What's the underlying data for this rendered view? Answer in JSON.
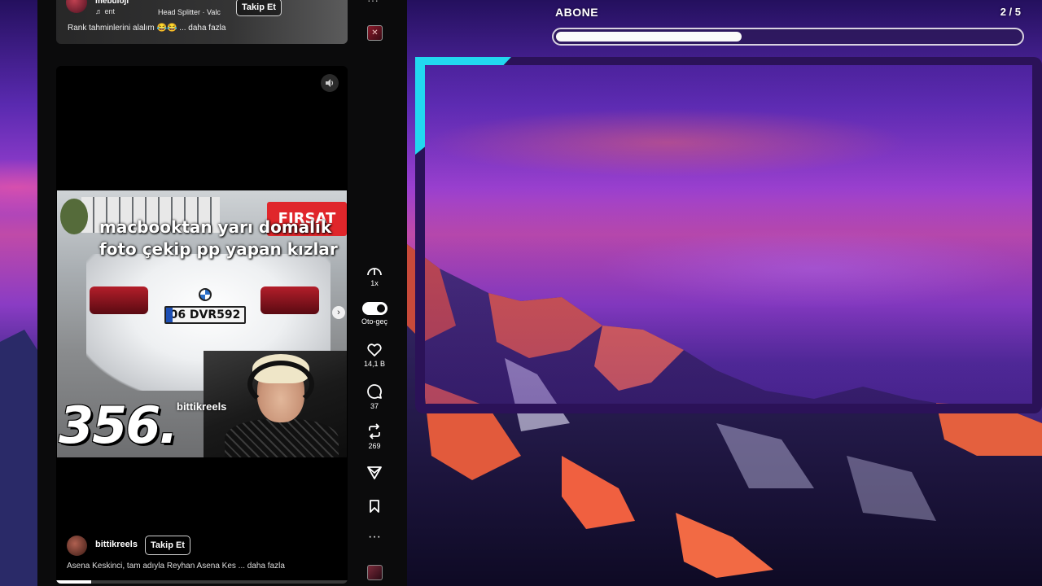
{
  "previous_reel": {
    "username": "mebuloji",
    "music_label": "♬ ent",
    "song": "Head Splitter · Valc",
    "follow_label": "Takip Et",
    "caption": "Rank tahminlerini alalım 😂😂 ... daha fazla"
  },
  "reel": {
    "overlay_text": "macbooktan yarı domalık\nfoto çekip pp yapan kızlar",
    "sale_badge": "FIRSAT",
    "plate": "06 DVR592",
    "big_number": "356.",
    "cam_label": "bittikreels",
    "username": "bittikreels",
    "follow_label": "Takip Et",
    "caption": "Asena Keskinci, tam adıyla Reyhan Asena Kes ... daha fazla",
    "progress": 0.12
  },
  "rail": {
    "speed_label": "1x",
    "autoplay_label": "Oto-geç",
    "autoplay_on": true,
    "likes": "14,1 B",
    "comments": "37",
    "reposts": "269",
    "more_glyph": "···"
  },
  "sub_goal": {
    "label": "ABONE",
    "count": "2 / 5",
    "current": 2,
    "target": 5
  },
  "colors": {
    "frame_accent": "#22d8f0",
    "frame_border": "#2b1258",
    "panel_bg": "#0b0b0c"
  }
}
